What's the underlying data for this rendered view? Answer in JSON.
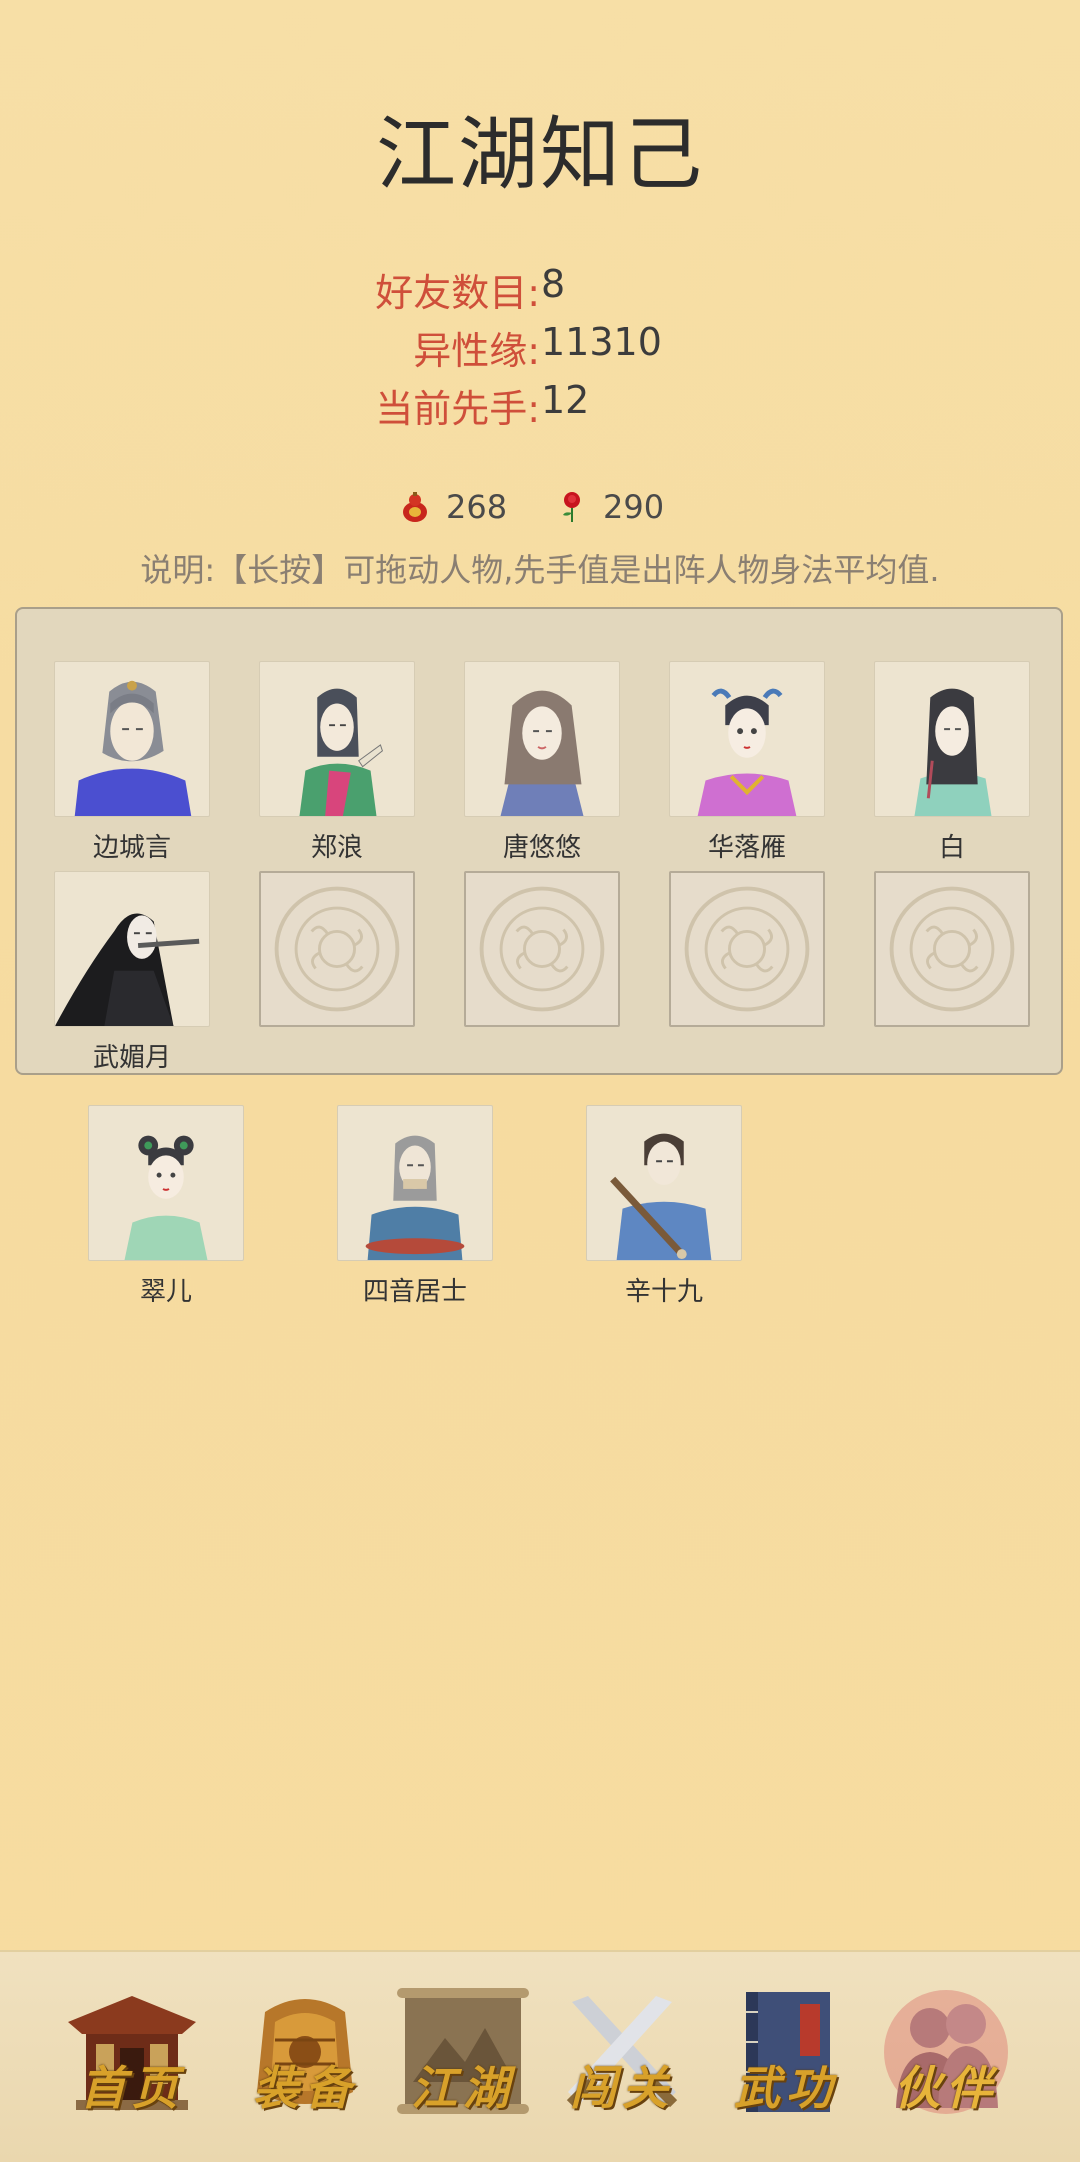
{
  "page": {
    "title": "江湖知己"
  },
  "stats": [
    {
      "label": "好友数目:",
      "value": "8"
    },
    {
      "label": "异性缘:",
      "value": "11310"
    },
    {
      "label": "当前先手:",
      "value": "12"
    }
  ],
  "resources": [
    {
      "icon": "gourd-icon",
      "value": "268"
    },
    {
      "icon": "rose-icon",
      "value": "290"
    }
  ],
  "description": "说明:【长按】可拖动人物,先手值是出阵人物身法平均值.",
  "team_slots": [
    {
      "name": "边城言",
      "filled": true
    },
    {
      "name": "郑浪",
      "filled": true
    },
    {
      "name": "唐悠悠",
      "filled": true
    },
    {
      "name": "华落雁",
      "filled": true
    },
    {
      "name": "白",
      "filled": true
    },
    {
      "name": "武媚月",
      "filled": true
    },
    {
      "name": "",
      "filled": false
    },
    {
      "name": "",
      "filled": false
    },
    {
      "name": "",
      "filled": false
    },
    {
      "name": "",
      "filled": false
    }
  ],
  "reserve": [
    {
      "name": "翠儿"
    },
    {
      "name": "四音居士"
    },
    {
      "name": "辛十九"
    }
  ],
  "nav": [
    {
      "label": "首页",
      "icon": "house-icon",
      "active": false
    },
    {
      "label": "装备",
      "icon": "armor-icon",
      "active": false
    },
    {
      "label": "江湖",
      "icon": "scroll-map-icon",
      "active": false
    },
    {
      "label": "闯关",
      "icon": "crossed-swords-icon",
      "active": false
    },
    {
      "label": "武功",
      "icon": "book-icon",
      "active": false
    },
    {
      "label": "伙伴",
      "icon": "partners-icon",
      "active": true
    }
  ],
  "colors": {
    "accent_red": "#cf4f3a",
    "gold": "#d8a12a",
    "panel": "#e2d7bd"
  }
}
